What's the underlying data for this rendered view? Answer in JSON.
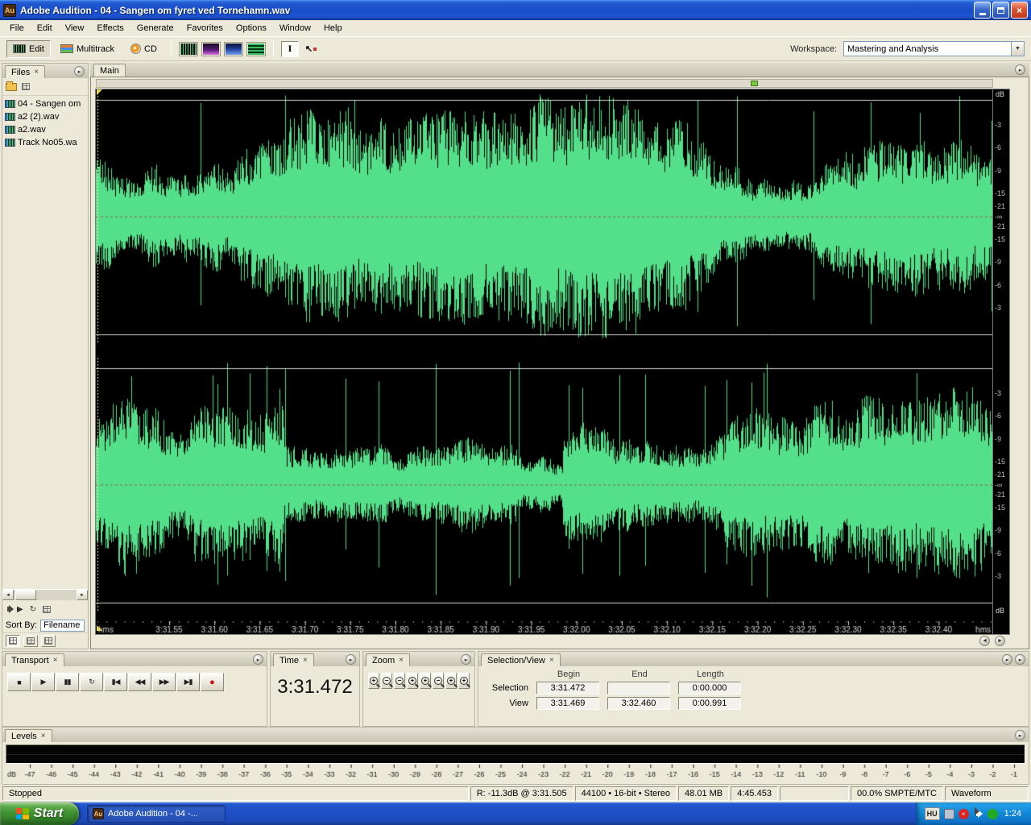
{
  "ui": {
    "close": "×",
    "panel_menu": "▸",
    "dropdown_arrow": "▼",
    "scroll_left": "◄",
    "scroll_right": "►"
  },
  "window": {
    "title": "Adobe Audition - 04 - Sangen om fyret ved Tornehamn.wav",
    "icon_text": "Au"
  },
  "menu_items": [
    "File",
    "Edit",
    "View",
    "Effects",
    "Generate",
    "Favorites",
    "Options",
    "Window",
    "Help"
  ],
  "toolbar": {
    "mode_buttons": [
      "Edit",
      "Multitrack",
      "CD"
    ],
    "text_tool_glyph": "I",
    "scrub_tool_glyph": "↖",
    "workspace_label": "Workspace:",
    "workspace_value": "Mastering and Analysis"
  },
  "files_panel": {
    "tab": "Files",
    "files": [
      "04 - Sangen om",
      "a2 (2).wav",
      "a2.wav",
      "Track No05.wa"
    ],
    "play_glyph": "▶",
    "loop_glyph": "↻",
    "sort_label": "Sort By:",
    "sort_value": "Filename"
  },
  "editor": {
    "tab": "Main",
    "waveform_color": "#54e08a",
    "db_unit": "dB",
    "db_labels": [
      {
        "t": "-3",
        "p": 14
      },
      {
        "t": "-6",
        "p": 23
      },
      {
        "t": "-9",
        "p": 32
      },
      {
        "t": "-15",
        "p": 41
      },
      {
        "t": "-21",
        "p": 46
      },
      {
        "t": "-∞",
        "p": 50
      },
      {
        "t": "-21",
        "p": 54
      },
      {
        "t": "-15",
        "p": 59
      },
      {
        "t": "-9",
        "p": 68
      },
      {
        "t": "-6",
        "p": 77
      },
      {
        "t": "-3",
        "p": 86
      }
    ],
    "ruler_unit": "hms",
    "ruler_ticks": [
      "3:31.55",
      "3:31.60",
      "3:31.65",
      "3:31.70",
      "3:31.75",
      "3:31.80",
      "3:31.85",
      "3:31.90",
      "3:31.95",
      "3:32.00",
      "3:32.05",
      "3:32.10",
      "3:32.15",
      "3:32.20",
      "3:32.25",
      "3:32.30",
      "3:32.35",
      "3:32.40"
    ]
  },
  "transport": {
    "tab": "Transport",
    "buttons": [
      {
        "name": "stop-button",
        "glyph": "■"
      },
      {
        "name": "play-button",
        "glyph": "▶"
      },
      {
        "name": "pause-button",
        "glyph": "▮▮"
      },
      {
        "name": "play-looped-button",
        "glyph": "↻"
      },
      {
        "name": "go-to-beginning-button",
        "glyph": "▮◀"
      },
      {
        "name": "rewind-button",
        "glyph": "◀◀"
      },
      {
        "name": "fast-forward-button",
        "glyph": "▶▶"
      },
      {
        "name": "go-to-end-button",
        "glyph": "▶▮"
      },
      {
        "name": "record-button",
        "glyph": "●",
        "cls": "rec"
      }
    ]
  },
  "time_panel": {
    "tab": "Time",
    "value": "3:31.472"
  },
  "zoom_panel": {
    "tab": "Zoom",
    "buttons": [
      {
        "name": "zoom-in-horizontal-button",
        "sign": "+"
      },
      {
        "name": "zoom-out-horizontal-button",
        "sign": "−"
      },
      {
        "name": "zoom-out-full-button",
        "sign": "−"
      },
      {
        "name": "zoom-to-selection-button",
        "sign": "+"
      },
      {
        "name": "zoom-in-vertical-button",
        "sign": "+"
      },
      {
        "name": "zoom-out-vertical-button",
        "sign": "−"
      },
      {
        "name": "zoom-left-edge-button",
        "sign": "+"
      },
      {
        "name": "zoom-right-edge-button",
        "sign": "+"
      }
    ]
  },
  "selection_panel": {
    "tab": "Selection/View",
    "columns": [
      "Begin",
      "End",
      "Length"
    ],
    "rows": [
      {
        "label": "Selection",
        "begin": "3:31.472",
        "end": "",
        "length": "0:00.000"
      },
      {
        "label": "View",
        "begin": "3:31.469",
        "end": "3:32.460",
        "length": "0:00.991"
      }
    ]
  },
  "levels_panel": {
    "tab": "Levels",
    "unit": "dB",
    "scale": [
      "-47",
      "-46",
      "-45",
      "-44",
      "-43",
      "-42",
      "-41",
      "-40",
      "-39",
      "-38",
      "-37",
      "-36",
      "-35",
      "-34",
      "-33",
      "-32",
      "-31",
      "-30",
      "-29",
      "-28",
      "-27",
      "-26",
      "-25",
      "-24",
      "-23",
      "-22",
      "-21",
      "-20",
      "-19",
      "-18",
      "-17",
      "-16",
      "-15",
      "-14",
      "-13",
      "-12",
      "-11",
      "-10",
      "-9",
      "-8",
      "-7",
      "-6",
      "-5",
      "-4",
      "-3",
      "-2",
      "-1"
    ]
  },
  "status": {
    "transport": "Stopped",
    "level": "R: -11.3dB @  3:31.505",
    "format": "44100 • 16-bit • Stereo",
    "size": "48.01 MB",
    "duration": "4:45.453",
    "sync": "00.0% SMPTE/MTC",
    "mode": "Waveform"
  },
  "taskbar": {
    "start_label": "Start",
    "task_label": "Adobe Audition - 04 -...",
    "language": "HU",
    "clock": "1:24"
  }
}
